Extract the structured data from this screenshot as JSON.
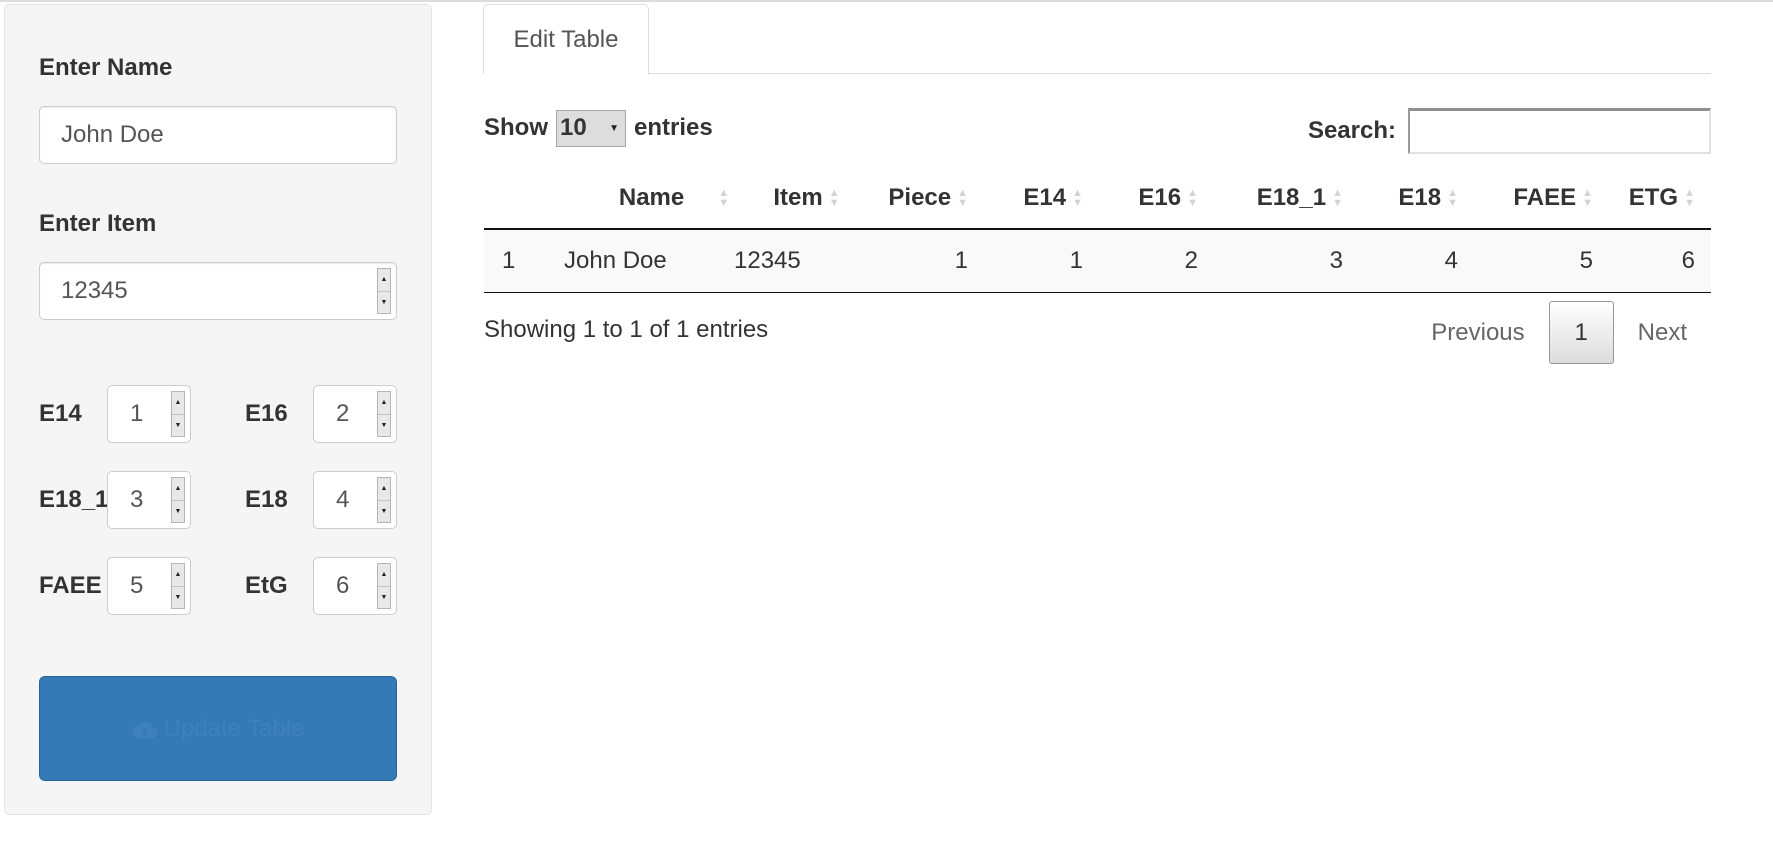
{
  "sidebar": {
    "name_label": "Enter Name",
    "name_value": "John Doe",
    "item_label": "Enter Item",
    "item_value": "12345",
    "fields": [
      {
        "label": "E14",
        "value": "1"
      },
      {
        "label": "E16",
        "value": "2"
      },
      {
        "label": "E18_1",
        "value": "3"
      },
      {
        "label": "E18",
        "value": "4"
      },
      {
        "label": "FAEE",
        "value": "5"
      },
      {
        "label": "EtG",
        "value": "6"
      }
    ],
    "update_button_label": "Update Table",
    "update_button_icon": "cloud-upload-icon"
  },
  "tabs": [
    {
      "label": "Edit Table",
      "active": true
    }
  ],
  "datatable": {
    "show_label": "Show",
    "entries_label": "entries",
    "page_length": "10",
    "search_label": "Search:",
    "search_value": "",
    "columns": [
      "",
      "Name",
      "Item",
      "Piece",
      "E14",
      "E16",
      "E18_1",
      "E18",
      "FAEE",
      "ETG"
    ],
    "rows": [
      [
        "1",
        "John Doe",
        "12345",
        "1",
        "1",
        "2",
        "3",
        "4",
        "5",
        "6"
      ]
    ],
    "info": "Showing 1 to 1 of 1 entries",
    "pagination": {
      "previous": "Previous",
      "current": "1",
      "next": "Next"
    }
  },
  "colors": {
    "primary_button": "#337ab7",
    "well_background": "#f5f5f5"
  }
}
